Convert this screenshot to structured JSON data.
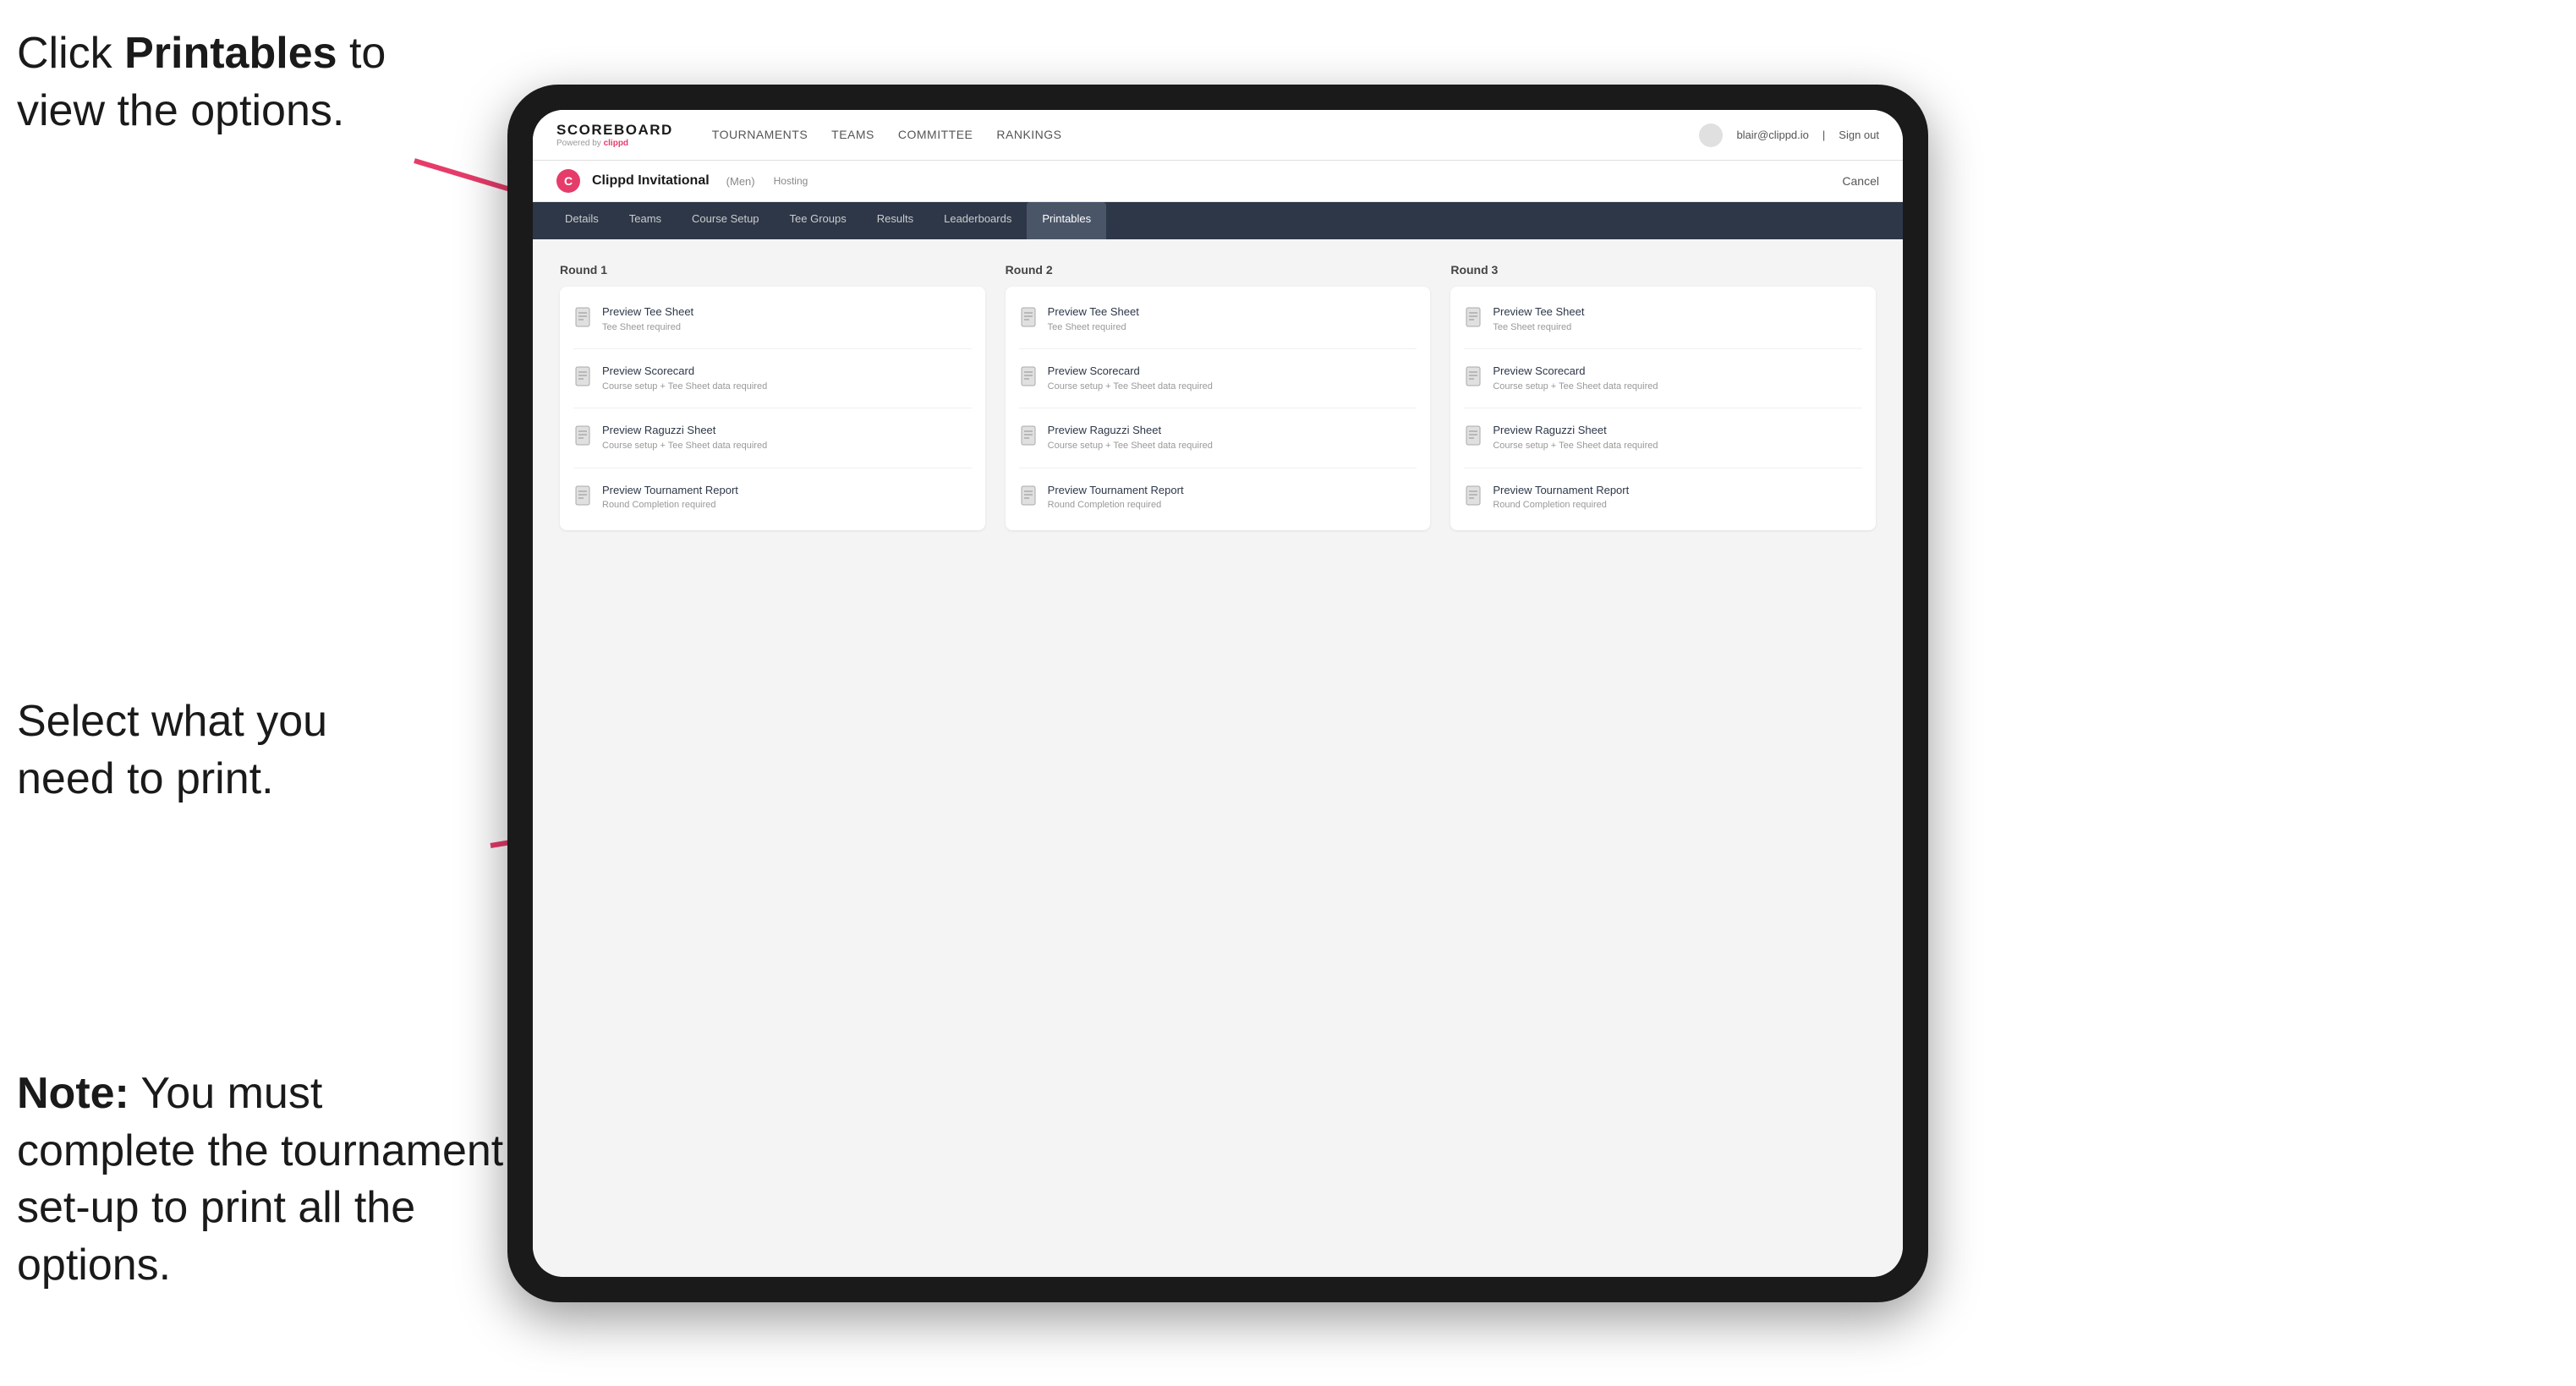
{
  "annotations": {
    "top_line1": "Click ",
    "top_bold": "Printables",
    "top_line2": " to",
    "top_line3": "view the options.",
    "middle_line1": "Select what you",
    "middle_line2": "need to print.",
    "bottom_bold": "Note:",
    "bottom_text": " You must complete the tournament set-up to print all the options."
  },
  "nav": {
    "logo_title": "SCOREBOARD",
    "powered_by": "Powered by",
    "powered_brand": "clippd",
    "items": [
      {
        "label": "TOURNAMENTS",
        "active": false
      },
      {
        "label": "TEAMS",
        "active": false
      },
      {
        "label": "COMMITTEE",
        "active": false
      },
      {
        "label": "RANKINGS",
        "active": false
      }
    ],
    "user_email": "blair@clippd.io",
    "sign_in_out": "Sign out"
  },
  "tournament": {
    "logo": "C",
    "name": "Clippd Invitational",
    "sub": "(Men)",
    "hosting": "Hosting",
    "cancel": "Cancel"
  },
  "tabs": [
    {
      "label": "Details",
      "active": false
    },
    {
      "label": "Teams",
      "active": false
    },
    {
      "label": "Course Setup",
      "active": false
    },
    {
      "label": "Tee Groups",
      "active": false
    },
    {
      "label": "Results",
      "active": false
    },
    {
      "label": "Leaderboards",
      "active": false
    },
    {
      "label": "Printables",
      "active": true
    }
  ],
  "rounds": [
    {
      "title": "Round 1",
      "items": [
        {
          "label": "Preview Tee Sheet",
          "sub": "Tee Sheet required"
        },
        {
          "label": "Preview Scorecard",
          "sub": "Course setup + Tee Sheet data required"
        },
        {
          "label": "Preview Raguzzi Sheet",
          "sub": "Course setup + Tee Sheet data required"
        },
        {
          "label": "Preview Tournament Report",
          "sub": "Round Completion required"
        }
      ]
    },
    {
      "title": "Round 2",
      "items": [
        {
          "label": "Preview Tee Sheet",
          "sub": "Tee Sheet required"
        },
        {
          "label": "Preview Scorecard",
          "sub": "Course setup + Tee Sheet data required"
        },
        {
          "label": "Preview Raguzzi Sheet",
          "sub": "Course setup + Tee Sheet data required"
        },
        {
          "label": "Preview Tournament Report",
          "sub": "Round Completion required"
        }
      ]
    },
    {
      "title": "Round 3",
      "items": [
        {
          "label": "Preview Tee Sheet",
          "sub": "Tee Sheet required"
        },
        {
          "label": "Preview Scorecard",
          "sub": "Course setup + Tee Sheet data required"
        },
        {
          "label": "Preview Raguzzi Sheet",
          "sub": "Course setup + Tee Sheet data required"
        },
        {
          "label": "Preview Tournament Report",
          "sub": "Round Completion required"
        }
      ]
    }
  ]
}
